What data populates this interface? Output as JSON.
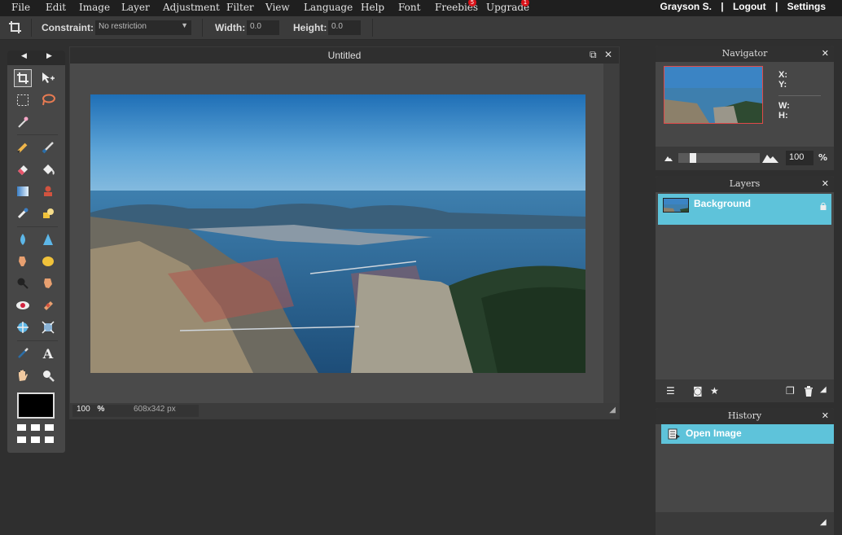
{
  "menu": {
    "items": [
      "File",
      "Edit",
      "Image",
      "Layer",
      "Adjustment",
      "Filter",
      "View",
      "Language",
      "Help",
      "Font",
      "Freebies",
      "Upgrade"
    ],
    "freebies_badge": "5",
    "upgrade_badge": "1"
  },
  "user": {
    "name": "Grayson S.",
    "logout": "Logout",
    "settings": "Settings",
    "separator": "|"
  },
  "options": {
    "constraint_label": "Constraint:",
    "constraint_value": "No restriction",
    "width_label": "Width:",
    "width_value": "0.0",
    "height_label": "Height:",
    "height_value": "0.0"
  },
  "document": {
    "title": "Untitled",
    "zoom_value": "100",
    "zoom_unit": "%",
    "dimensions": "608x342 px"
  },
  "navigator": {
    "title": "Navigator",
    "x_label": "X:",
    "y_label": "Y:",
    "w_label": "W:",
    "h_label": "H:",
    "zoom_value": "100",
    "zoom_unit": "%",
    "slider_level_percent": 15
  },
  "layers": {
    "title": "Layers",
    "items": [
      {
        "name": "Background",
        "locked": true
      }
    ]
  },
  "history": {
    "title": "History",
    "items": [
      {
        "name": "Open Image"
      }
    ]
  },
  "colors": {
    "accent": "#5ec3da",
    "badge": "#d9131a"
  }
}
